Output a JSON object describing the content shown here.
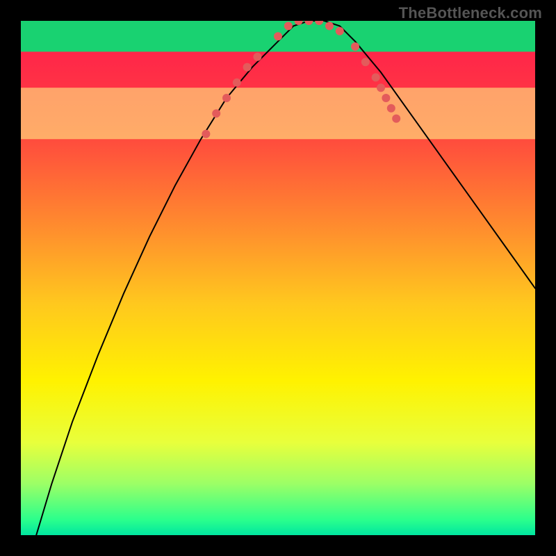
{
  "watermark": "TheBottleneck.com",
  "chart_data": {
    "type": "line",
    "title": "",
    "xlabel": "",
    "ylabel": "",
    "xlim": [
      0,
      100
    ],
    "ylim": [
      0,
      100
    ],
    "grid": false,
    "legend": false,
    "background": {
      "type": "vertical-gradient",
      "stops": [
        {
          "pos": 0.0,
          "color": "#ff1a4d"
        },
        {
          "pos": 0.2,
          "color": "#ff4040"
        },
        {
          "pos": 0.4,
          "color": "#ff8c2e"
        },
        {
          "pos": 0.55,
          "color": "#ffc81e"
        },
        {
          "pos": 0.7,
          "color": "#fff200"
        },
        {
          "pos": 0.82,
          "color": "#e8ff3c"
        },
        {
          "pos": 0.9,
          "color": "#9cff66"
        },
        {
          "pos": 0.97,
          "color": "#2bff8c"
        },
        {
          "pos": 1.0,
          "color": "#00e6a0"
        }
      ]
    },
    "highlight_bands": [
      {
        "y_from": 77,
        "y_to": 87,
        "color": "#ffff8a",
        "opacity": 0.55
      },
      {
        "y_from": 94,
        "y_to": 100,
        "color": "#00e676",
        "opacity": 0.9
      }
    ],
    "series": [
      {
        "name": "bottleneck-curve",
        "stroke": "#000000",
        "stroke_width": 2,
        "x": [
          3,
          6,
          10,
          15,
          20,
          25,
          30,
          35,
          40,
          45,
          50,
          53,
          56,
          59,
          62,
          65,
          70,
          75,
          80,
          85,
          90,
          95,
          100
        ],
        "y": [
          0,
          10,
          22,
          35,
          47,
          58,
          68,
          77,
          85,
          91,
          96,
          99,
          100,
          100,
          99,
          96,
          90,
          83,
          76,
          69,
          62,
          55,
          48
        ]
      }
    ],
    "markers": {
      "name": "curve-dots",
      "color": "#e35b5b",
      "radius": 6,
      "points": [
        {
          "x": 36,
          "y": 78
        },
        {
          "x": 38,
          "y": 82
        },
        {
          "x": 40,
          "y": 85
        },
        {
          "x": 42,
          "y": 88
        },
        {
          "x": 44,
          "y": 91
        },
        {
          "x": 46,
          "y": 93
        },
        {
          "x": 50,
          "y": 97
        },
        {
          "x": 52,
          "y": 99
        },
        {
          "x": 54,
          "y": 100
        },
        {
          "x": 56,
          "y": 100
        },
        {
          "x": 58,
          "y": 100
        },
        {
          "x": 60,
          "y": 99
        },
        {
          "x": 62,
          "y": 98
        },
        {
          "x": 65,
          "y": 95
        },
        {
          "x": 67,
          "y": 92
        },
        {
          "x": 69,
          "y": 89
        },
        {
          "x": 70,
          "y": 87
        },
        {
          "x": 71,
          "y": 85
        },
        {
          "x": 72,
          "y": 83
        },
        {
          "x": 73,
          "y": 81
        }
      ]
    }
  }
}
